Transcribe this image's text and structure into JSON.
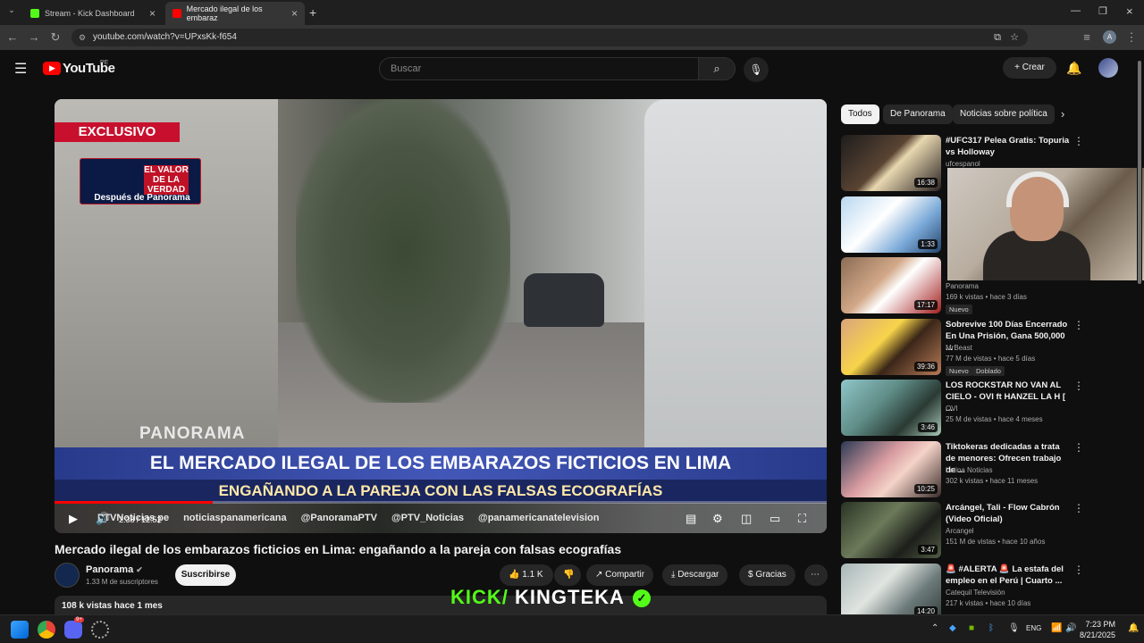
{
  "browser": {
    "tabs": [
      {
        "label": "Stream - Kick Dashboard",
        "active": false,
        "favicon_color": "#53fc18"
      },
      {
        "label": "Mercado ilegal de los embaraz",
        "active": true,
        "favicon_color": "#ff0000"
      }
    ],
    "url": "youtube.com/watch?v=UPxsKk-f654"
  },
  "youtube": {
    "logo": "YouTube",
    "region": "PE",
    "search_placeholder": "Buscar",
    "create_label": "Crear"
  },
  "video": {
    "overlay_exclusivo": "EXCLUSIVO",
    "overlay_valor": "EL VALOR DE LA VERDAD",
    "overlay_despues": "Después de Panorama",
    "overlay_panorama": "PANORAMA",
    "banner_line1": "EL MERCADO ILEGAL DE LOS EMBARAZOS FICTICIOS EN LIMA",
    "banner_line2": "ENGAÑANDO A LA PAREJA CON LAS FALSAS ECOGRAFÍAS",
    "social": [
      "PTVNoticias.pe",
      "noticiaspanamericana",
      "@PanoramaPTV",
      "@PTV_Noticias",
      "@panamericanatelevision"
    ],
    "time_current": "2:38",
    "time_total": "12:52",
    "progress_fraction": 0.205,
    "title": "Mercado ilegal de los embarazos ficticios en Lima: engañando a la pareja con falsas ecografías",
    "channel": "Panorama",
    "subscribers": "1.33 M de suscriptores",
    "subscribe_label": "Suscribirse",
    "likes": "1.1 K",
    "share_label": "Compartir",
    "download_label": "Descargar",
    "thanks_label": "Gracias",
    "views_line": "108 k vistas  hace 1 mes"
  },
  "chips": [
    "Todos",
    "De Panorama",
    "Noticias sobre política"
  ],
  "recommendations": [
    {
      "title": "#UFC317 Pelea Gratis: Topuria vs Holloway",
      "channel": "ufcespanol",
      "meta": "",
      "duration": "16:38",
      "badges": [],
      "thumb": "linear-gradient(135deg,#1d1d1d,#5a4433 45%,#e8d8b0 55%,#2a2222)"
    },
    {
      "title": "",
      "channel": "",
      "meta": "",
      "duration": "1:33",
      "badges": [],
      "thumb": "linear-gradient(135deg,#b9d7f0,#ffffff 40%,#7aa9d8 70%,#24456a)"
    },
    {
      "title": "",
      "channel": "Panorama",
      "meta": "169 k vistas • hace 3 días",
      "duration": "17:17",
      "badges": [
        "Nuevo"
      ],
      "thumb": "linear-gradient(135deg,#8b6c55,#d2a888 40%,#ffffff 55%,#a31e1e)"
    },
    {
      "title": "Sobrevive 100 Días Encerrado En Una Prisión, Gana 500,000 ...",
      "channel": "MrBeast",
      "meta": "77 M de vistas • hace 5 días",
      "duration": "39:36",
      "badges": [
        "Nuevo",
        "Doblado"
      ],
      "thumb": "linear-gradient(135deg,#d9a47c,#f7d44a 40%,#3b2618 60%,#b77b58)"
    },
    {
      "title": "LOS ROCKSTAR NO VAN AL CIELO - OVI ft HANZEL LA H [ ...",
      "channel": "OVI",
      "meta": "25 M de vistas • hace 4 meses",
      "duration": "3:46",
      "badges": [],
      "thumb": "linear-gradient(135deg,#8fc6c9,#5f8c86 40%,#2a3a34 70%,#a9c8b8)"
    },
    {
      "title": "Tiktokeras dedicadas a trata de menores: Ofrecen trabajo de ...",
      "channel": "Latina Noticias",
      "meta": "302 k vistas • hace 11 meses",
      "duration": "10:25",
      "badges": [],
      "thumb": "linear-gradient(135deg,#2b3a55,#d79ba0 40%,#f4d3c8 60%,#3a2c2a)"
    },
    {
      "title": "Arcángel, Tali - Flow Cabrón (Video Oficial)",
      "channel": "Arcangel",
      "meta": "151 M de vistas • hace 10 años",
      "duration": "3:47",
      "badges": [],
      "thumb": "linear-gradient(135deg,#2a3324,#6c7a5a 40%,#1c1f1a 70%,#515c45)"
    },
    {
      "title": "🚨 #ALERTA 🚨 La estafa del empleo en el Perú | Cuarto ...",
      "channel": "Catequil Televisión",
      "meta": "217 k vistas • hace 10 días",
      "duration": "14:20",
      "badges": [],
      "thumb": "linear-gradient(135deg,#a8b7b7,#e0e4e0 40%,#6a7878 70%,#35403d)"
    }
  ],
  "overlay": {
    "kick_prefix": "KICK/",
    "kick_name": "KINGTEKA"
  },
  "taskbar": {
    "language": "ENG",
    "time": "7:23 PM",
    "date": "8/21/2025",
    "discord_badge": "9+"
  }
}
